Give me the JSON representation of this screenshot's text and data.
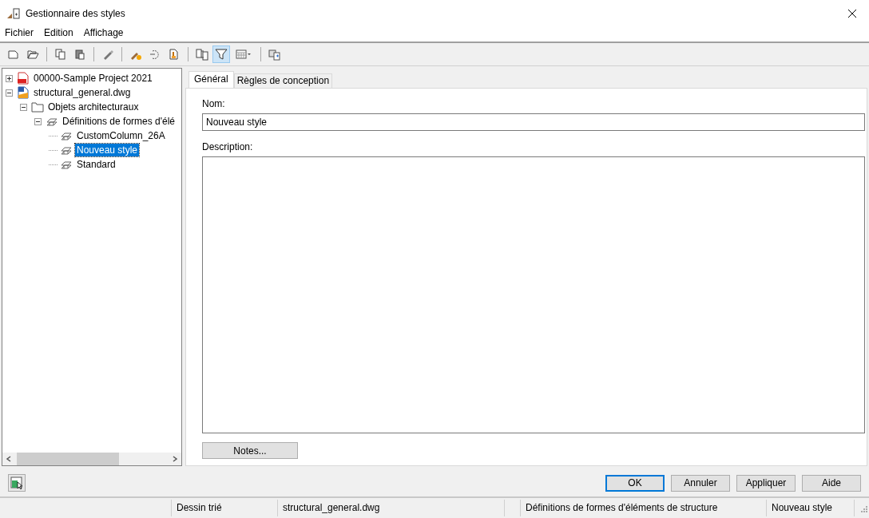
{
  "window": {
    "title": "Gestionnaire des styles"
  },
  "menu": [
    "Fichier",
    "Edition",
    "Affichage"
  ],
  "toolbar": [
    {
      "kind": "new",
      "pressed": false
    },
    {
      "kind": "open",
      "pressed": false
    },
    {
      "kind": "separator"
    },
    {
      "kind": "copy",
      "pressed": false
    },
    {
      "kind": "paste",
      "pressed": false
    },
    {
      "kind": "separator"
    },
    {
      "kind": "edit",
      "pressed": false
    },
    {
      "kind": "separator"
    },
    {
      "kind": "newstyle",
      "pressed": false
    },
    {
      "kind": "purge",
      "pressed": false
    },
    {
      "kind": "clean",
      "pressed": false
    },
    {
      "kind": "separator"
    },
    {
      "kind": "compare",
      "pressed": false
    },
    {
      "kind": "filter",
      "pressed": true
    },
    {
      "kind": "view",
      "pressed": false
    },
    {
      "kind": "separator"
    },
    {
      "kind": "sync",
      "pressed": false
    }
  ],
  "tree": [
    {
      "label": "00000-Sample Project 2021",
      "kind": "project",
      "expanded": false,
      "selected": false
    },
    {
      "label": "structural_general.dwg",
      "kind": "drawing",
      "expanded": true,
      "selected": false,
      "children": [
        {
          "label": "Objets architecturaux",
          "kind": "folder",
          "expanded": true,
          "selected": false,
          "children": [
            {
              "label": "Définitions de formes d'élé",
              "kind": "member",
              "expanded": true,
              "selected": false,
              "children": [
                {
                  "label": "CustomColumn_26A",
                  "kind": "member",
                  "selected": false
                },
                {
                  "label": "Nouveau style",
                  "kind": "member",
                  "selected": true
                },
                {
                  "label": "Standard",
                  "kind": "member",
                  "selected": false
                }
              ]
            }
          ]
        }
      ]
    }
  ],
  "tabs": [
    {
      "label": "Général",
      "selected": true
    },
    {
      "label": "Règles de conception",
      "selected": false
    }
  ],
  "form": {
    "name_label": "Nom:",
    "name_value": "Nouveau style",
    "description_label": "Description:",
    "notes_button": "Notes..."
  },
  "buttons": [
    {
      "label": "OK",
      "default": true
    },
    {
      "label": "Annuler",
      "default": false
    },
    {
      "label": "Appliquer",
      "default": false
    },
    {
      "label": "Aide",
      "default": false
    }
  ],
  "status_bar": [
    "Dessin trié",
    "structural_general.dwg",
    "Définitions de formes d'éléments de structure",
    "Nouveau style"
  ]
}
